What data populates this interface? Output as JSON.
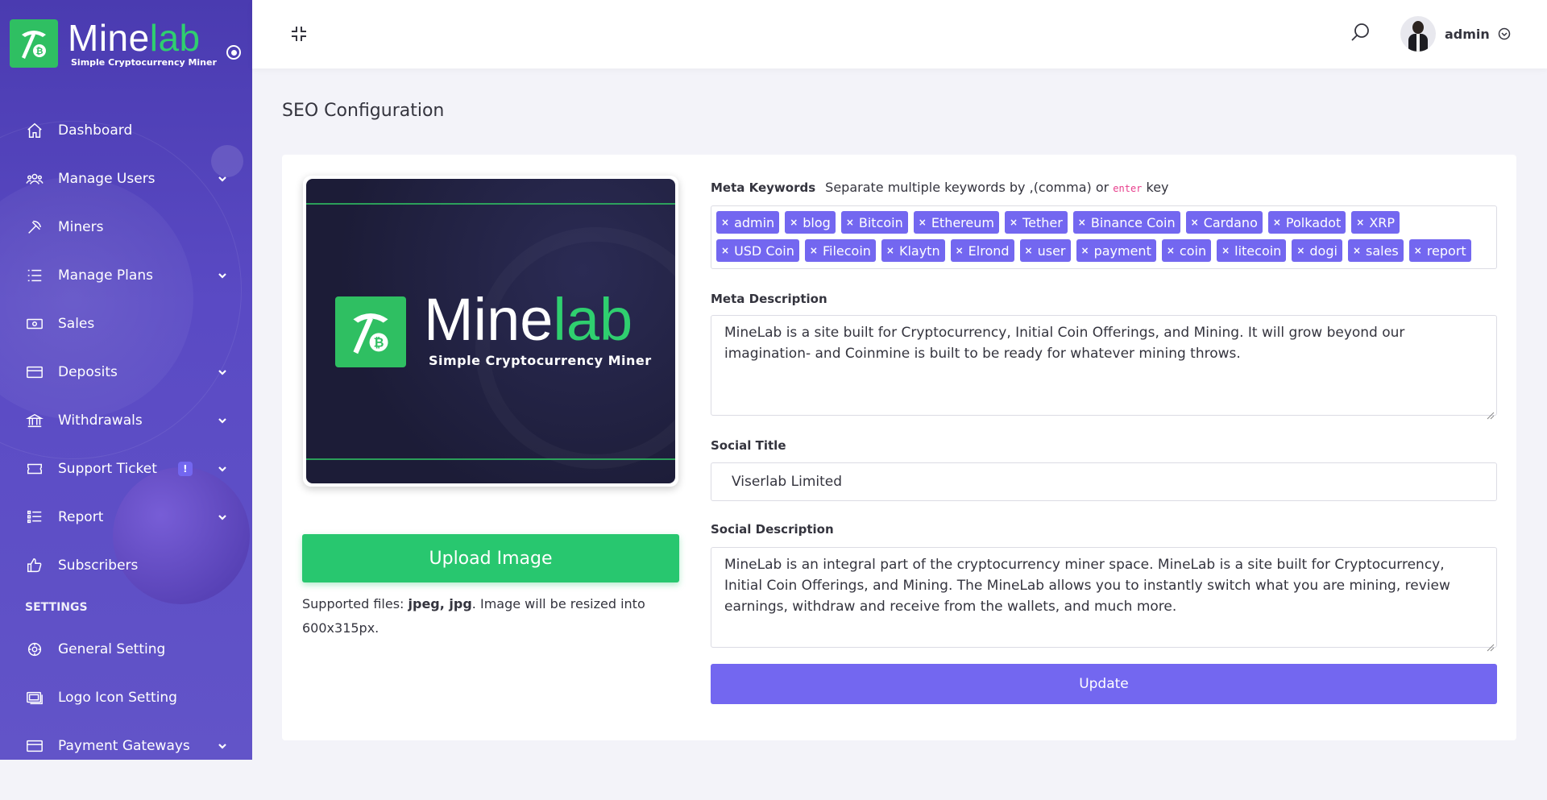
{
  "brand": {
    "name_main": "Mine",
    "name_accent": "lab",
    "tagline": "Simple Cryptocurrency Miner"
  },
  "sidebar": {
    "items": [
      {
        "label": "Dashboard",
        "icon": "home-icon"
      },
      {
        "label": "Manage Users",
        "icon": "users-icon"
      },
      {
        "label": "Miners",
        "icon": "pickaxe-icon"
      },
      {
        "label": "Manage Plans",
        "icon": "list-icon"
      },
      {
        "label": "Sales",
        "icon": "money-icon"
      },
      {
        "label": "Deposits",
        "icon": "card-icon"
      },
      {
        "label": "Withdrawals",
        "icon": "bank-icon"
      },
      {
        "label": "Support Ticket",
        "icon": "ticket-icon",
        "badge": "!"
      },
      {
        "label": "Report",
        "icon": "report-icon"
      },
      {
        "label": "Subscribers",
        "icon": "thumbs-up-icon"
      }
    ],
    "section_settings": "SETTINGS",
    "settings_items": [
      {
        "label": "General Setting",
        "icon": "settings-icon"
      },
      {
        "label": "Logo Icon Setting",
        "icon": "images-icon"
      },
      {
        "label": "Payment Gateways",
        "icon": "card-icon"
      }
    ]
  },
  "topbar": {
    "username": "admin"
  },
  "page": {
    "title": "SEO Configuration"
  },
  "seo": {
    "preview": {
      "name_main": "Mine",
      "name_accent": "lab",
      "tagline": "Simple Cryptocurrency Miner"
    },
    "upload_label": "Upload Image",
    "upload_note_prefix": "Supported files: ",
    "upload_note_types": "jpeg, jpg",
    "upload_note_suffix": ". Image will be resized into 600x315px.",
    "meta_keywords_label": "Meta Keywords",
    "meta_keywords_hint_pre": "Separate multiple keywords by ",
    "meta_keywords_hint_comma": ",",
    "meta_keywords_hint_mid": "(comma) or ",
    "meta_keywords_hint_key": "enter",
    "meta_keywords_hint_post": " key",
    "keywords": [
      "admin",
      "blog",
      "Bitcoin",
      "Ethereum",
      "Tether",
      "Binance Coin",
      "Cardano",
      "Polkadot",
      "XRP",
      "USD Coin",
      "Filecoin",
      "Klaytn",
      "Elrond",
      "user",
      "payment",
      "coin",
      "litecoin",
      "dogi",
      "sales",
      "report"
    ],
    "meta_description_label": "Meta Description",
    "meta_description": "MineLab is a site built for Cryptocurrency, Initial Coin Offerings, and Mining. It will grow beyond our imagination- and Coinmine is built to be ready for whatever mining throws.",
    "social_title_label": "Social Title",
    "social_title": "Viserlab Limited",
    "social_description_label": "Social Description",
    "social_description": "MineLab is an integral part of the cryptocurrency miner space. MineLab is a site built for Cryptocurrency, Initial Coin Offerings, and Mining. The MineLab allows you to instantly switch what you are mining, review earnings, withdraw and receive from the wallets, and much more.",
    "update_label": "Update"
  },
  "colors": {
    "sidebar": "#5a4ac4",
    "primary": "#7367f0",
    "success": "#28c76f",
    "brand_green": "#2fbf62"
  }
}
